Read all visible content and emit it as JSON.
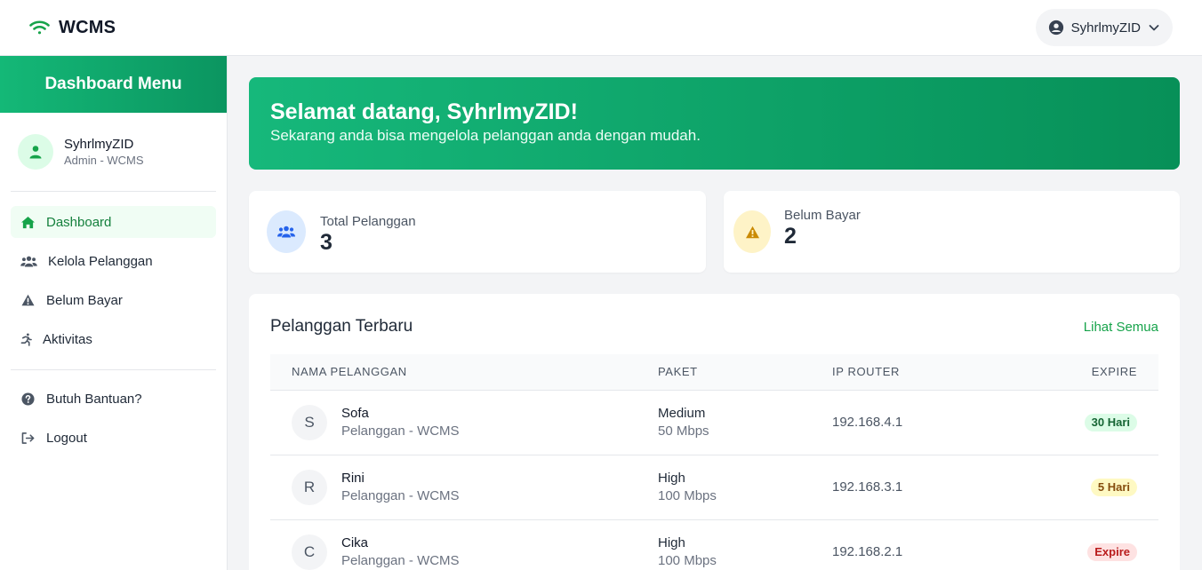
{
  "header": {
    "brand": "WCMS",
    "user_name": "SyhrlmyZID"
  },
  "sidebar": {
    "title": "Dashboard Menu",
    "profile": {
      "name": "SyhrlmyZID",
      "role": "Admin - WCMS"
    },
    "items": [
      {
        "label": "Dashboard",
        "icon": "home-icon",
        "active": true
      },
      {
        "label": "Kelola Pelanggan",
        "icon": "users-icon"
      },
      {
        "label": "Belum Bayar",
        "icon": "warning-icon"
      },
      {
        "label": "Aktivitas",
        "icon": "running-icon"
      }
    ],
    "secondary": [
      {
        "label": "Butuh Bantuan?",
        "icon": "question-icon"
      },
      {
        "label": "Logout",
        "icon": "logout-icon"
      }
    ]
  },
  "banner": {
    "title": "Selamat datang, SyhrlmyZID!",
    "subtitle": "Sekarang anda bisa mengelola pelanggan anda dengan mudah."
  },
  "stats": [
    {
      "label": "Total Pelanggan",
      "value": "3",
      "icon": "users-icon",
      "color": "#2563eb"
    },
    {
      "label": "Belum Bayar",
      "value": "2",
      "icon": "warning-icon",
      "color": "#ca8a04"
    }
  ],
  "customers": {
    "title": "Pelanggan Terbaru",
    "see_all": "Lihat Semua",
    "columns": [
      "NAMA PELANGGAN",
      "PAKET",
      "IP ROUTER",
      "EXPIRE"
    ],
    "rows": [
      {
        "initial": "S",
        "name": "Sofa",
        "sub": "Pelanggan - WCMS",
        "package": "Medium",
        "speed": "50 Mbps",
        "ip": "192.168.4.1",
        "expire": "30 Hari",
        "status_color": "green"
      },
      {
        "initial": "R",
        "name": "Rini",
        "sub": "Pelanggan - WCMS",
        "package": "High",
        "speed": "100 Mbps",
        "ip": "192.168.3.1",
        "expire": "5 Hari",
        "status_color": "yellow"
      },
      {
        "initial": "C",
        "name": "Cika",
        "sub": "Pelanggan - WCMS",
        "package": "High",
        "speed": "100 Mbps",
        "ip": "192.168.2.1",
        "expire": "Expire",
        "status_color": "red"
      }
    ]
  },
  "colors": {
    "accent": "#16a34a",
    "banner_start": "#16b87b",
    "banner_end": "#079058"
  }
}
